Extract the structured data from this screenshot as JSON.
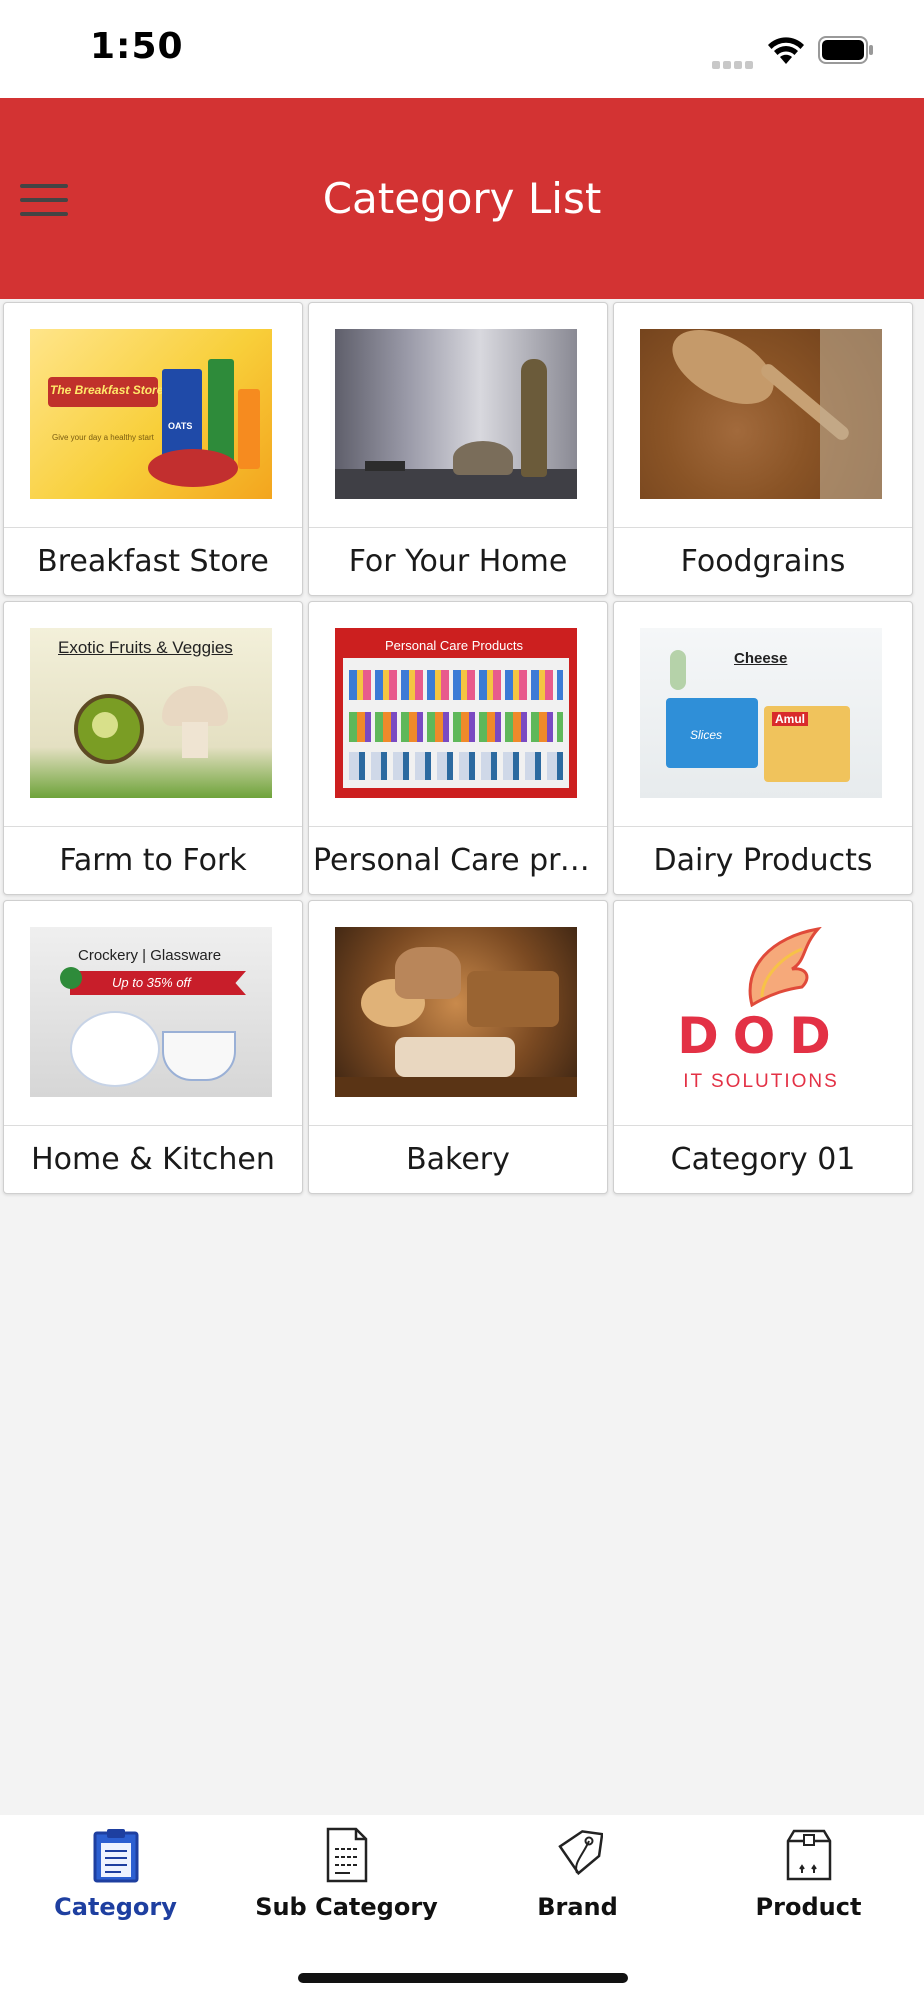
{
  "status_bar": {
    "time": "1:50"
  },
  "header": {
    "title": "Category List"
  },
  "categories": [
    {
      "label": "Breakfast Store",
      "image": "breakfast-store-image",
      "image_text": [
        "The Breakfast Store",
        "Give your day a healthy start",
        "OATS"
      ]
    },
    {
      "label": "For Your Home",
      "image": "for-your-home-image"
    },
    {
      "label": "Foodgrains",
      "image": "foodgrains-image"
    },
    {
      "label": "Farm to Fork",
      "image": "farm-to-fork-image",
      "image_text": [
        "Exotic Fruits & Veggies"
      ]
    },
    {
      "label": "Personal Care prod...",
      "image": "personal-care-image",
      "image_text": [
        "Personal Care Products"
      ]
    },
    {
      "label": "Dairy Products",
      "image": "dairy-products-image",
      "image_text": [
        "Cheese",
        "Slices",
        "Amul"
      ]
    },
    {
      "label": "Home & Kitchen",
      "image": "home-kitchen-image",
      "image_text": [
        "Crockery | Glassware",
        "Up to 35% off"
      ]
    },
    {
      "label": "Bakery",
      "image": "bakery-image"
    },
    {
      "label": "Category 01",
      "image": "dod-logo-image",
      "image_text": [
        "DOD",
        "IT SOLUTIONS"
      ]
    }
  ],
  "bottom_nav": {
    "items": [
      {
        "label": "Category",
        "icon": "clipboard-icon",
        "active": true
      },
      {
        "label": "Sub Category",
        "icon": "document-icon",
        "active": false
      },
      {
        "label": "Brand",
        "icon": "tag-icon",
        "active": false
      },
      {
        "label": "Product",
        "icon": "box-icon",
        "active": false
      }
    ]
  },
  "colors": {
    "header": "#d33333",
    "active_nav": "#1e3fa0",
    "background": "#f3f3f3"
  }
}
